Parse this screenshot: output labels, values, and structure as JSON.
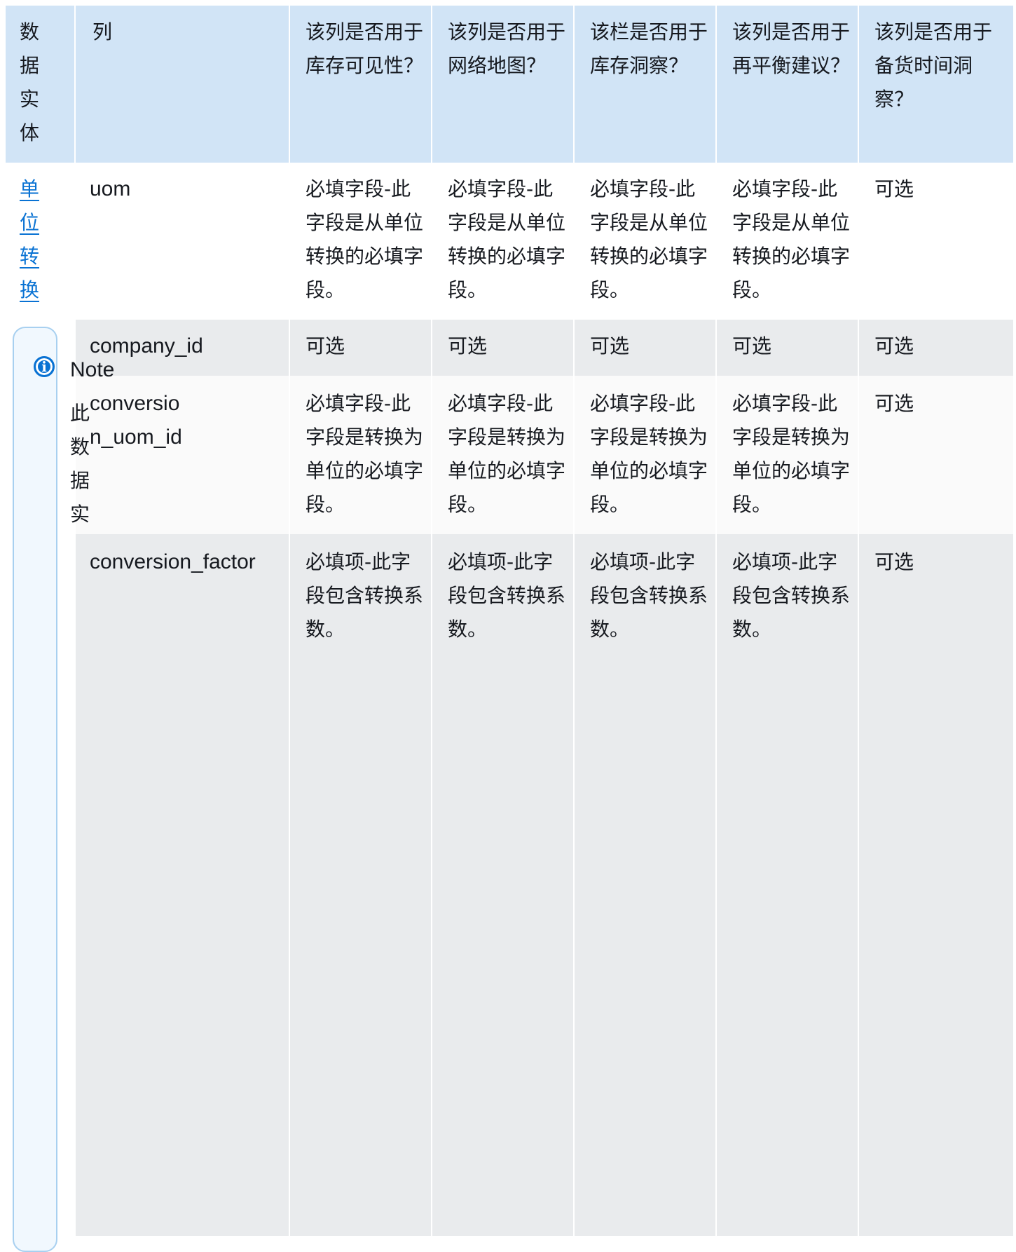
{
  "table": {
    "headers": {
      "entity": "数据实体",
      "column": "列",
      "inventory_visibility": "该列是否用于库存可见性？",
      "network_map": "该列是否用于网络地图？",
      "inventory_insights": "该栏是否用于库存洞察？",
      "rebalance": "该列是否用于再平衡建议？",
      "lead_time": "该列是否用于备货时间洞察？"
    },
    "entity_link": "单位转换",
    "rows": [
      {
        "column": "uom",
        "inventory_visibility": "必填字段-此字段是从单位转换的必填字段。",
        "network_map": "必填字段-此字段是从单位转换的必填字段。",
        "inventory_insights": "必填字段-此字段是从单位转换的必填字段。",
        "rebalance": "必填字段-此字段是从单位转换的必填字段。",
        "lead_time": "可选"
      },
      {
        "column": "company_id",
        "inventory_visibility": "可选",
        "network_map": "可选",
        "inventory_insights": "可选",
        "rebalance": "可选",
        "lead_time": "可选"
      },
      {
        "column": "conversion_uom_id",
        "inventory_visibility": "必填字段-此字段是转换为单位的必填字段。",
        "network_map": "必填字段-此字段是转换为单位的必填字段。",
        "inventory_insights": "必填字段-此字段是转换为单位的必填字段。",
        "rebalance": "必填字段-此字段是转换为单位的必填字段。",
        "lead_time": "可选"
      },
      {
        "column": "conversion_factor",
        "inventory_visibility": "必填项-此字段包含转换系数。",
        "network_map": "必填项-此字段包含转换系数。",
        "inventory_insights": "必填项-此字段包含转换系数。",
        "rebalance": "必填项-此字段包含转换系数。",
        "lead_time": "可选"
      }
    ]
  },
  "note": {
    "icon": "info-icon",
    "title": "Note",
    "body": "此数据实"
  },
  "colors": {
    "header_bg": "#d1e4f6",
    "row_alt_bg": "#e9ebed",
    "link": "#0972d3",
    "note_border": "#a8d0f0"
  }
}
